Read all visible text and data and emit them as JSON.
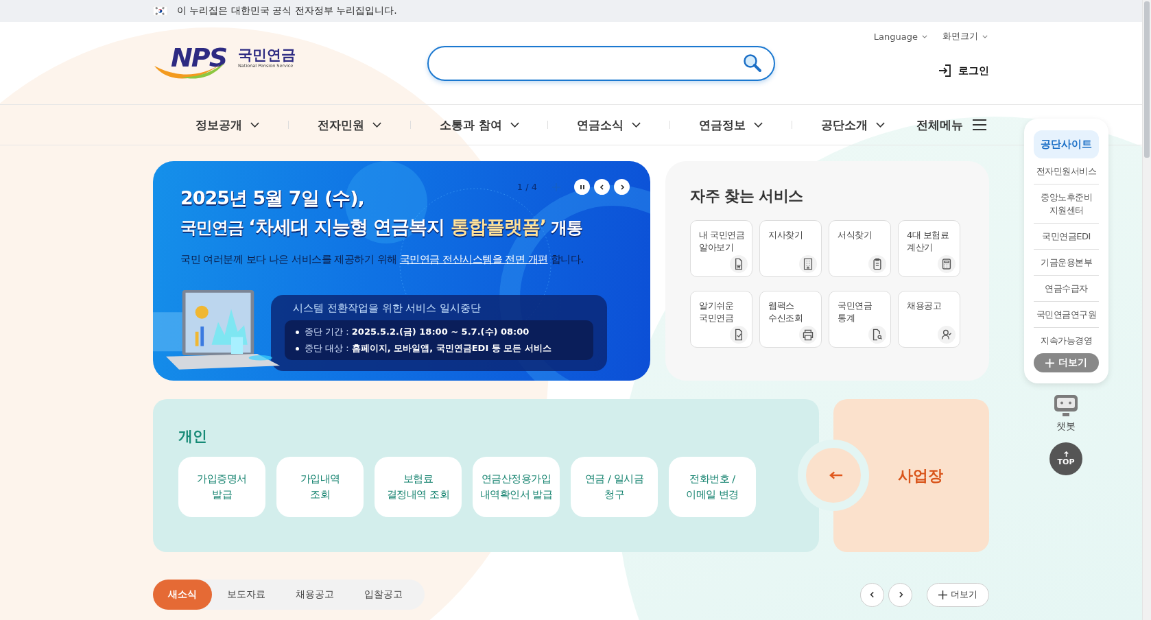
{
  "gov_banner": {
    "text": "이 누리집은 대한민국 공식 전자정부 누리집입니다."
  },
  "header": {
    "logo": {
      "mark": "NPS",
      "name": "국민연금",
      "subtitle": "National Pension Service"
    },
    "utility": [
      {
        "label": "Language"
      },
      {
        "label": "화면크기"
      }
    ],
    "login": {
      "label": "로그인"
    }
  },
  "nav": [
    {
      "label": "정보공개",
      "kind": "dropdown"
    },
    {
      "label": "전자민원",
      "kind": "dropdown"
    },
    {
      "label": "소통과 참여",
      "kind": "dropdown"
    },
    {
      "label": "연금소식",
      "kind": "dropdown"
    },
    {
      "label": "연금정보",
      "kind": "dropdown"
    },
    {
      "label": "공단소개",
      "kind": "dropdown"
    },
    {
      "label": "전체메뉴",
      "kind": "all-menu"
    }
  ],
  "banner": {
    "counter": "1 / 4",
    "headline_1": "2025년 5월 7일 (수),",
    "headline_2": [
      {
        "text": "국민연금 ",
        "kind": "plain"
      },
      {
        "text": "‘차세대 지능형 연금복지 ",
        "kind": "quote"
      },
      {
        "text": "통합플랫폼’",
        "kind": "highlight"
      },
      {
        "text": " 개통",
        "kind": "plain"
      }
    ],
    "sentence": {
      "before": "국민 여러분께 보다 나은 서비스를 제공하기 위해 ",
      "link": "국민연금 전산시스템을 전면 개편",
      "after": " 합니다."
    },
    "notice": {
      "title": "시스템 전환작업을 위한 서비스 일시중단",
      "items": [
        {
          "label": "중단 기간 :",
          "value": "2025.5.2.(금) 18:00 ~ 5.7.(수) 08:00"
        },
        {
          "label": "중단 대상 :",
          "value": "홈페이지, 모바일앱, 국민연금EDI 등 모든 서비스"
        }
      ]
    }
  },
  "services": {
    "title": "자주 찾는 서비스",
    "items": [
      {
        "label": "내 국민연금\n알아보기",
        "kind": "document-won"
      },
      {
        "label": "지사찾기",
        "kind": "building"
      },
      {
        "label": "서식찾기",
        "kind": "clipboard"
      },
      {
        "label": "4대 보험료\n계산기",
        "kind": "calculator"
      },
      {
        "label": "알기쉬운\n국민연금",
        "kind": "document-check"
      },
      {
        "label": "웹팩스\n수신조회",
        "kind": "printer"
      },
      {
        "label": "국민연금\n통계",
        "kind": "document-search"
      },
      {
        "label": "채용공고",
        "kind": "person-check"
      }
    ]
  },
  "personal": {
    "title": "개인",
    "items": [
      {
        "label": "가입증명서\n발급"
      },
      {
        "label": "가입내역\n조회"
      },
      {
        "label": "보험료\n결정내역 조회"
      },
      {
        "label": "연금산정용가입\n내역확인서 발급"
      },
      {
        "label": "연금 / 일시금\n청구"
      },
      {
        "label": "전화번호 /\n이메일 변경"
      }
    ]
  },
  "business": {
    "title": "사업장"
  },
  "news": {
    "tabs": [
      {
        "label": "새소식",
        "selected": true
      },
      {
        "label": "보도자료",
        "selected": false
      },
      {
        "label": "채용공고",
        "selected": false
      },
      {
        "label": "입찰공고",
        "selected": false
      }
    ],
    "more": "더보기"
  },
  "quick_menu": {
    "title": "공단사이트",
    "items": [
      "전자민원서비스",
      "중앙노후준비\n지원센터",
      "국민연금EDI",
      "기금운용본부",
      "연금수급자",
      "국민연금연구원",
      "지속가능경영"
    ],
    "more": "더보기"
  },
  "chatbot": {
    "label": "챗봇"
  },
  "top": {
    "label": "TOP"
  }
}
